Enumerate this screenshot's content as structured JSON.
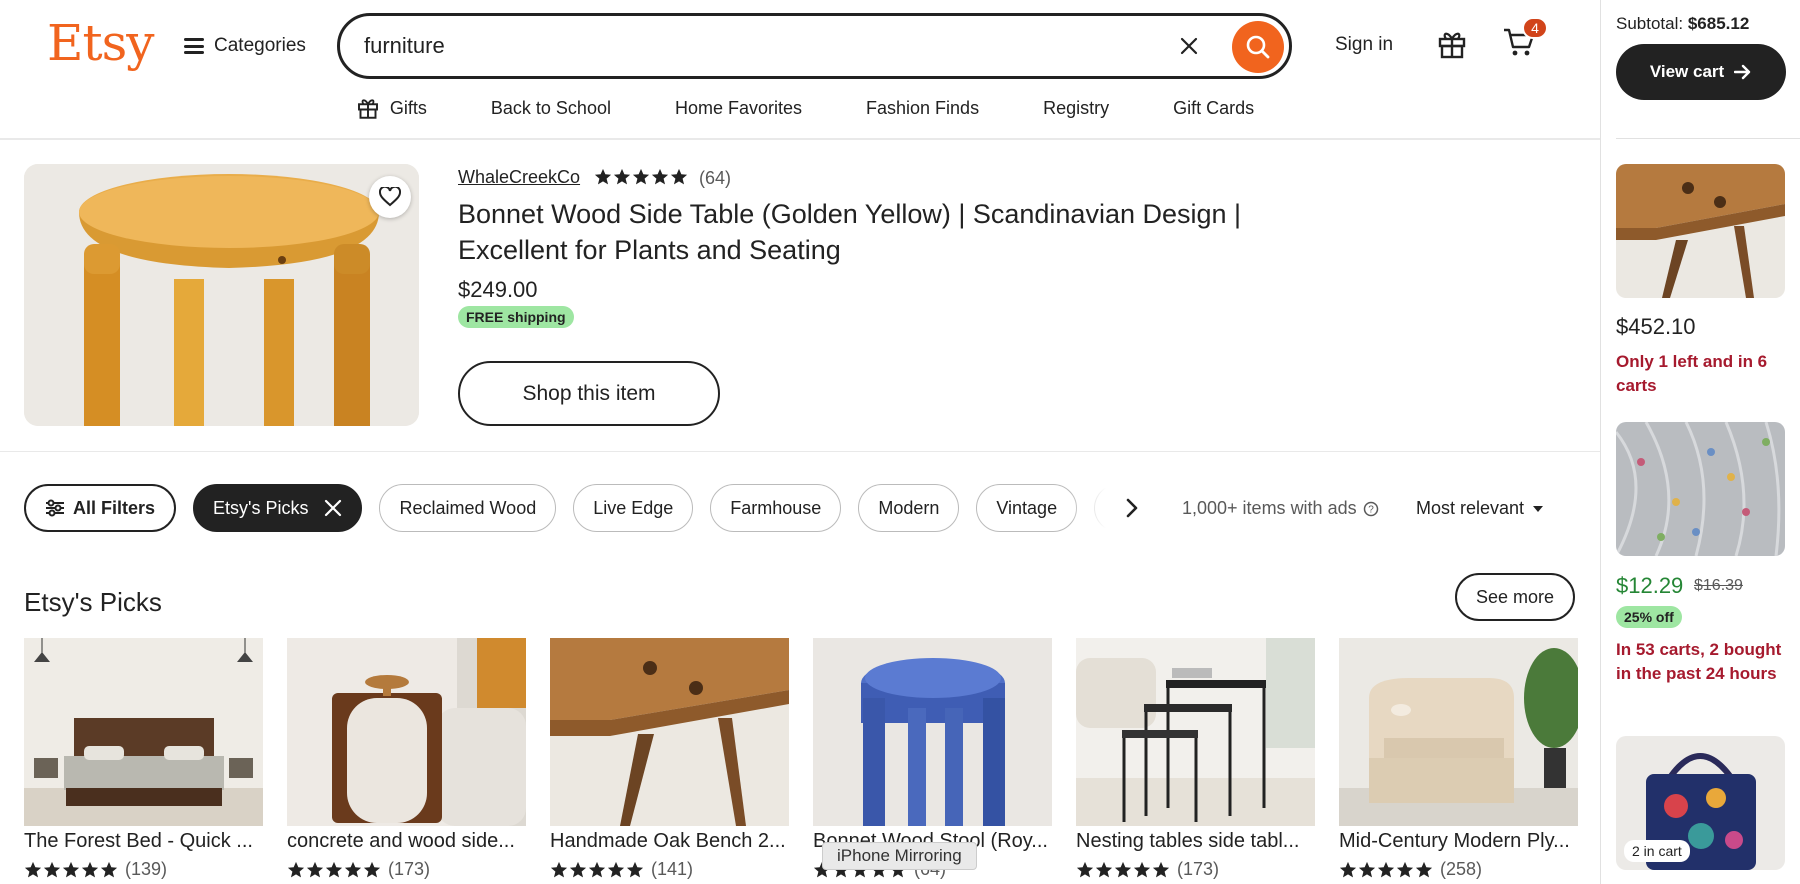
{
  "header": {
    "logo": "Etsy",
    "categories_label": "Categories",
    "search_value": "furniture",
    "sign_in_label": "Sign in",
    "cart_count": "4"
  },
  "subnav": [
    {
      "label": "Gifts",
      "icon": "gift-icon"
    },
    {
      "label": "Back to School"
    },
    {
      "label": "Home Favorites"
    },
    {
      "label": "Fashion Finds"
    },
    {
      "label": "Registry"
    },
    {
      "label": "Gift Cards"
    }
  ],
  "featured": {
    "shop_name": "WhaleCreekCo",
    "rating_count": "(64)",
    "title": "Bonnet Wood Side Table (Golden Yellow) | Scandinavian Design | Excellent for Plants and Seating",
    "price": "$249.00",
    "shipping_badge": "FREE shipping",
    "cta_label": "Shop this item"
  },
  "filters": {
    "all_filters_label": "All Filters",
    "active_chip": "Etsy's Picks",
    "chips": [
      "Reclaimed Wood",
      "Live Edge",
      "Farmhouse",
      "Modern",
      "Vintage"
    ],
    "results_text": "1,000+ items with ads",
    "sort_label": "Most relevant"
  },
  "picks": {
    "title": "Etsy's Picks",
    "see_more_label": "See more",
    "items": [
      {
        "title": "The Forest Bed - Quick ...",
        "count": "(139)"
      },
      {
        "title": "concrete and wood side...",
        "count": "(173)"
      },
      {
        "title": "Handmade Oak Bench 2...",
        "count": "(141)"
      },
      {
        "title": "Bonnet Wood Stool (Roy...",
        "count": "(64)"
      },
      {
        "title": "Nesting tables side tabl...",
        "count": "(173)"
      },
      {
        "title": "Mid-Century Modern Ply...",
        "count": "(258)"
      }
    ]
  },
  "tooltip": "iPhone Mirroring",
  "cart_rail": {
    "subtotal_label": "Subtotal:",
    "subtotal_value": "$685.12",
    "view_cart_label": "View cart",
    "item1": {
      "price": "$452.10",
      "note": "Only 1 left and in 6 carts"
    },
    "item2": {
      "sale_price": "$12.29",
      "original_price": "$16.39",
      "discount": "25% off",
      "note": "In 53 carts, 2 bought in the past 24 hours"
    },
    "item3": {
      "badge": "2 in cart"
    }
  },
  "colors": {
    "brand": "#f1641e",
    "dark": "#222222",
    "sale_green": "#258635",
    "badge_green": "#9ee6a2",
    "alert_red": "#a61a2e"
  }
}
